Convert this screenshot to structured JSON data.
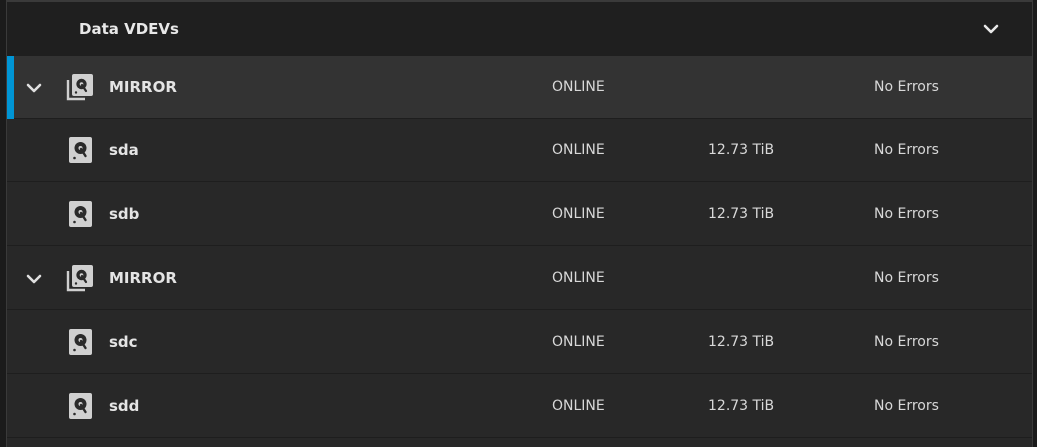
{
  "panel": {
    "title": "Data VDEVs",
    "collapse_icon": "chevron-down-icon"
  },
  "colors": {
    "accent": "#0095d5",
    "background": "#282828",
    "header_background": "#1f1f1f"
  },
  "rows": [
    {
      "type": "vdev",
      "name": "MIRROR",
      "status": "ONLINE",
      "size": "",
      "errors": "No Errors",
      "expanded": true,
      "selected": true
    },
    {
      "type": "disk",
      "name": "sda",
      "status": "ONLINE",
      "size": "12.73 TiB",
      "errors": "No Errors"
    },
    {
      "type": "disk",
      "name": "sdb",
      "status": "ONLINE",
      "size": "12.73 TiB",
      "errors": "No Errors"
    },
    {
      "type": "vdev",
      "name": "MIRROR",
      "status": "ONLINE",
      "size": "",
      "errors": "No Errors",
      "expanded": true,
      "selected": false
    },
    {
      "type": "disk",
      "name": "sdc",
      "status": "ONLINE",
      "size": "12.73 TiB",
      "errors": "No Errors"
    },
    {
      "type": "disk",
      "name": "sdd",
      "status": "ONLINE",
      "size": "12.73 TiB",
      "errors": "No Errors"
    }
  ]
}
